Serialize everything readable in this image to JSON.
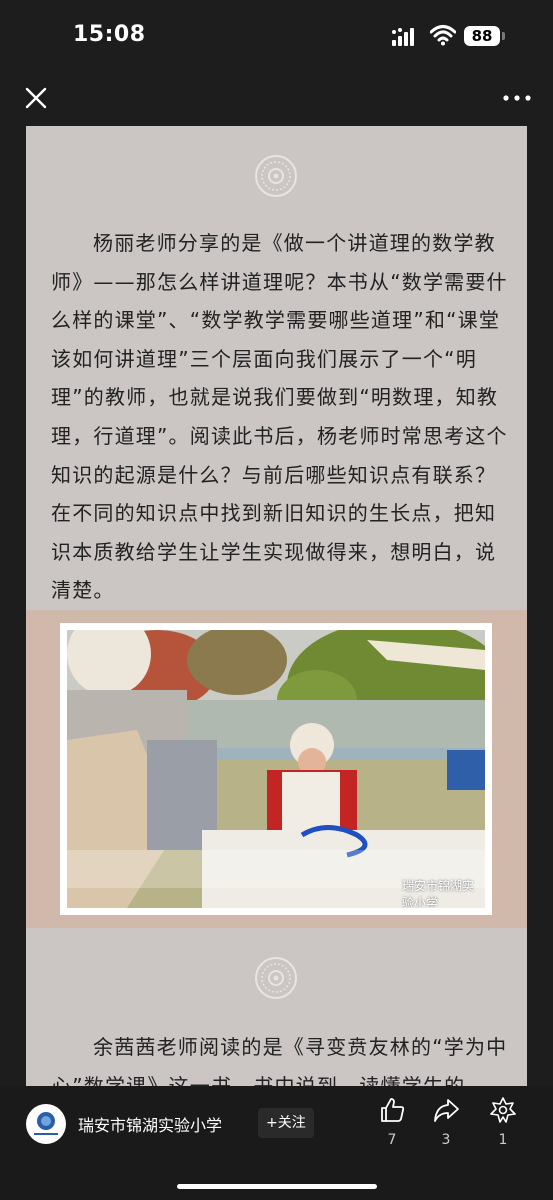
{
  "status": {
    "time": "15:08",
    "battery": "88"
  },
  "article": {
    "paragraph_1": "杨丽老师分享的是《做一个讲道理的数学教师》——那怎么样讲道理呢？本书从“数学需要什么样的课堂”、“数学教学需要哪些道理”和“课堂该如何讲道理”三个层面向我们展示了一个“明理”的教师，也就是说我们要做到“明数理，知教理，行道理”。阅读此书后，杨老师时常思考这个知识的起源是什么？与前后哪些知识点有联系？在不同的知识点中找到新旧知识的生长点，把知识本质教给学生让学生实现做得来，想明白，说清楚。",
    "paragraph_2": "余茜茜老师阅读的是《寻变贲友林的“学为中心”数学课》这一书，书中说到，读懂学生的",
    "photo_watermark": "瑞安市锦湖实验小学"
  },
  "footer": {
    "account_name": "瑞安市锦湖实验小学",
    "follow_label": "+关注",
    "like_count": "7",
    "share_count": "3",
    "recommend_count": "1"
  },
  "icons": {
    "close": "close-icon",
    "more": "more-icon",
    "like": "thumbs-up-icon",
    "share": "share-icon",
    "recommend": "recommend-icon",
    "ornament": "circular-ornament-icon"
  },
  "colors": {
    "article_bg": "#cbc6c4",
    "photo_frame": "#d0b8aa",
    "app_bg": "#1d1d1d",
    "text": "#222222"
  }
}
